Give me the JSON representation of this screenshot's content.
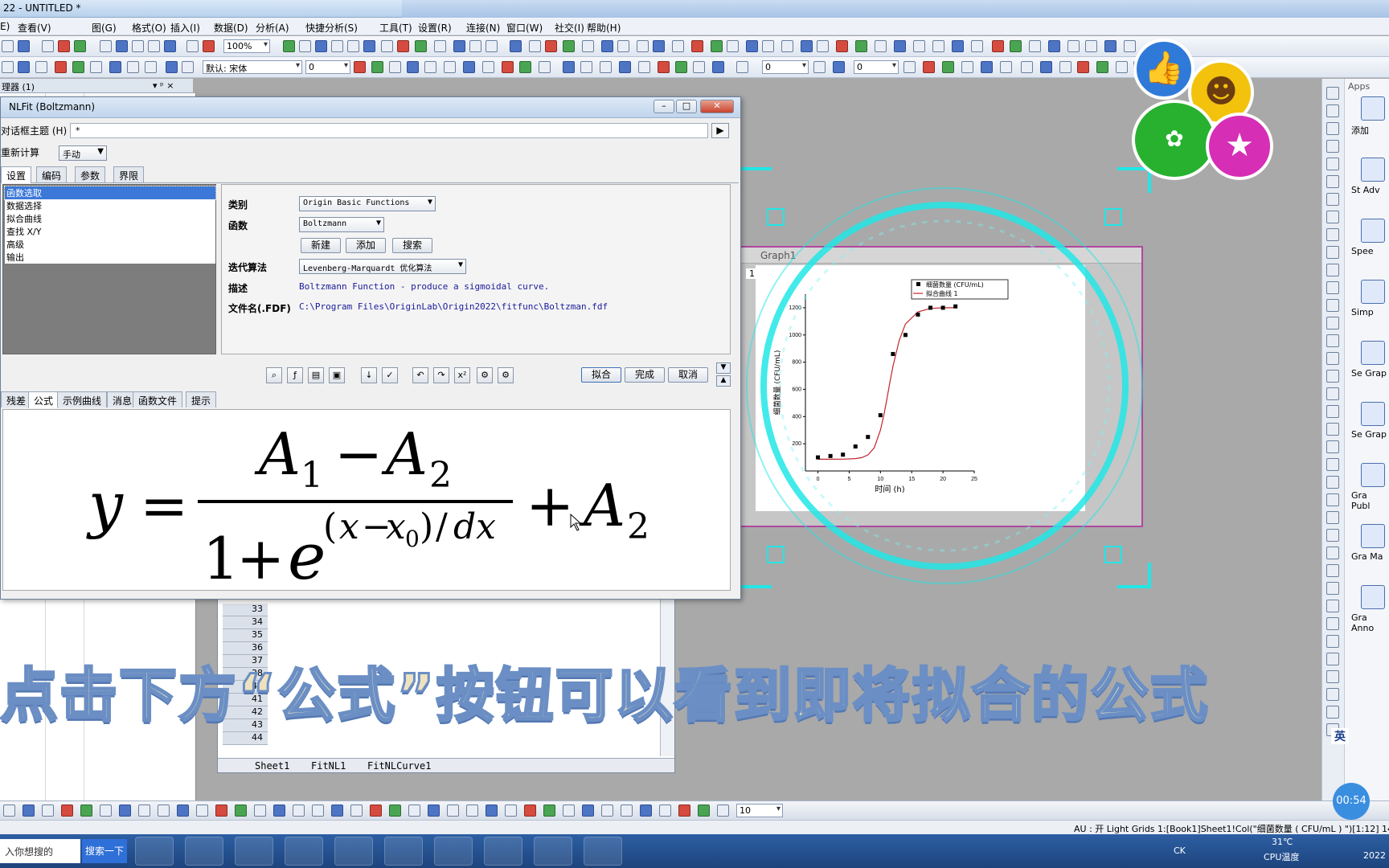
{
  "app": {
    "title": "22 - UNTITLED *"
  },
  "menu": [
    "E)",
    "查看(V)",
    "图(G)",
    "格式(O)",
    "插入(I)",
    "数据(D)",
    "分析(A)",
    "快捷分析(S)",
    "工具(T)",
    "设置(R)",
    "连接(N)",
    "窗口(W)",
    "社交(I)",
    "帮助(H)"
  ],
  "toolbar": {
    "zoom": "100%",
    "font": "默认: 宋体",
    "size1": "0",
    "size2": "0",
    "size3": "0",
    "size4": "0"
  },
  "panel": {
    "header": "理器 (1)"
  },
  "dialog": {
    "title": "NLFit (Boltzmann)",
    "theme_label": "对话框主题 (H)",
    "theme_value": "*",
    "recalc_label": "重新计算",
    "recalc_value": "手动",
    "tabs": [
      "设置",
      "编码",
      "参数",
      "界限"
    ],
    "tree": [
      "函数选取",
      "数据选择",
      "拟合曲线",
      "查找 X/Y",
      "高级",
      "输出"
    ],
    "category_label": "类别",
    "category_value": "Origin Basic Functions",
    "function_label": "函数",
    "function_value": "Boltzmann",
    "btn_new": "新建",
    "btn_add": "添加",
    "btn_search": "搜索",
    "algo_label": "迭代算法",
    "algo_value": "Levenberg-Marquardt 优化算法",
    "desc_label": "描述",
    "desc_value": "Boltzmann Function - produce a sigmoidal curve.",
    "file_label": "文件名(.FDF)",
    "file_value": "C:\\Program Files\\OriginLab\\Origin2022\\fitfunc\\Boltzman.fdf",
    "btn_fit": "拟合",
    "btn_done": "完成",
    "btn_cancel": "取消",
    "lower_tabs": [
      "残差",
      "公式",
      "示例曲线",
      "消息",
      "函数文件",
      "提示"
    ]
  },
  "sheet": {
    "rows": [
      "33",
      "34",
      "35",
      "36",
      "37",
      "38",
      "40",
      "41",
      "42",
      "43",
      "44"
    ],
    "tabs": [
      "Sheet1",
      "FitNL1",
      "FitNLCurve1"
    ]
  },
  "graph": {
    "title": "Graph1",
    "layer": "1",
    "xlabel": "时间 (h)",
    "ylabel": "细菌数量 (CFU/mL)",
    "legend": [
      "细菌数量 (CFU/mL)",
      "拟合曲线 1"
    ]
  },
  "chart_data": {
    "type": "scatter",
    "title": "",
    "xlabel": "时间 (h)",
    "ylabel": "细菌数量 (CFU/mL)",
    "xlim": [
      -2,
      25
    ],
    "ylim": [
      0,
      1300
    ],
    "xticks": [
      "0",
      "5",
      "10",
      "15",
      "20",
      "25"
    ],
    "yticks": [
      "200",
      "400",
      "600",
      "800",
      "1000",
      "1200"
    ],
    "series": [
      {
        "name": "细菌数量 (CFU/mL)",
        "x": [
          0,
          2,
          4,
          6,
          8,
          10,
          12,
          14,
          16,
          18,
          20,
          22
        ],
        "y": [
          100,
          110,
          120,
          180,
          250,
          410,
          860,
          1000,
          1150,
          1200,
          1200,
          1210
        ]
      },
      {
        "name": "拟合曲线 1",
        "x": [
          0,
          2,
          4,
          6,
          7,
          8,
          9,
          10,
          10.5,
          11,
          11.5,
          12,
          13,
          14,
          16,
          18,
          20,
          22
        ],
        "y": [
          86,
          86,
          87,
          91,
          98,
          118,
          170,
          300,
          400,
          520,
          650,
          770,
          960,
          1080,
          1170,
          1195,
          1200,
          1200
        ]
      }
    ],
    "legend": "top-right"
  },
  "overlay": {
    "caption": "点击下方“公式”按钮可以看到即将拟合的公式"
  },
  "apps": {
    "label": "Apps",
    "items": [
      "添加",
      "St Adv",
      "Spee",
      "Simp",
      "Se Grap",
      "Se Grap",
      "Gra Publ",
      "Gra Ma",
      "Gra Anno"
    ]
  },
  "status": {
    "text": "AU : 开  Light Grids  1:[Book1]Sheet1!Col(\"细菌数量 ( CFU/mL ) \")[1:12]  14KB"
  },
  "taskbar": {
    "search_placeholder": "入你想搜的",
    "search_btn": "搜索一下",
    "temp": "31℃",
    "cpu": "CPU温度",
    "year": "2022",
    "lang": "英",
    "timer": "00:54",
    "ck": "CK"
  },
  "bottom": {
    "zoom": "10"
  },
  "colors": {
    "accent": "#3b78d8",
    "formula_ink": "#000000",
    "caption": "#efe2c0",
    "caption_stroke": "#6b8fc4",
    "hud": "#22e6e6"
  }
}
